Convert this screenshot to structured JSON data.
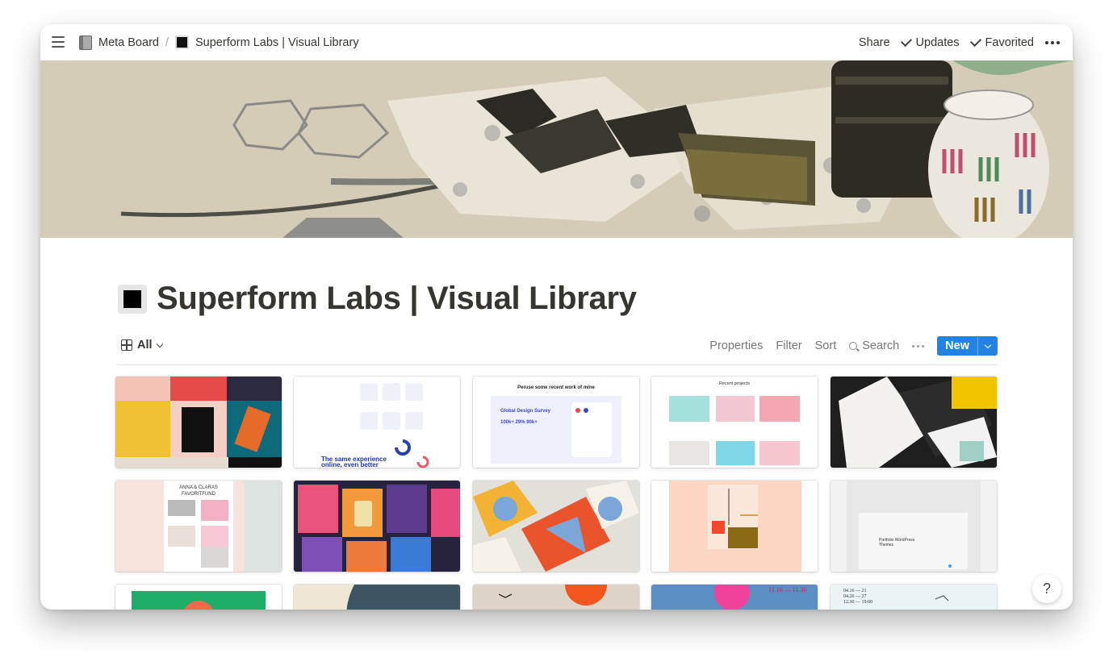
{
  "topbar": {
    "breadcrumbs": [
      {
        "label": "Meta Board",
        "icon": "book-icon"
      },
      {
        "label": "Superform Labs | Visual Library",
        "icon": "black-square-icon"
      }
    ],
    "separator": "/",
    "share_label": "Share",
    "updates_label": "Updates",
    "favorited_label": "Favorited"
  },
  "page": {
    "title": "Superform Labs | Visual Library",
    "icon": "black-square-icon"
  },
  "view": {
    "current_view": "All",
    "properties_label": "Properties",
    "filter_label": "Filter",
    "sort_label": "Sort",
    "search_label": "Search",
    "new_label": "New",
    "accent_color": "#2383e2"
  },
  "gallery": {
    "card_texts": {
      "card2_headline": "The same experience online, even better",
      "card3_heading": "Peruse some recent work of mine",
      "card3_subtitle": "Global Design Survey",
      "card4_heading": "Recent projects",
      "card6_title": "ANNA & CLARAS FAVORITFUND",
      "card10_title": "Portfolio WordPress Themes",
      "card15_dates": [
        "04.16 — 21",
        "04.26 — 27",
        "12.30 — 19:00"
      ],
      "card14_dates": "11.16 — 11.30"
    }
  },
  "help_label": "?"
}
